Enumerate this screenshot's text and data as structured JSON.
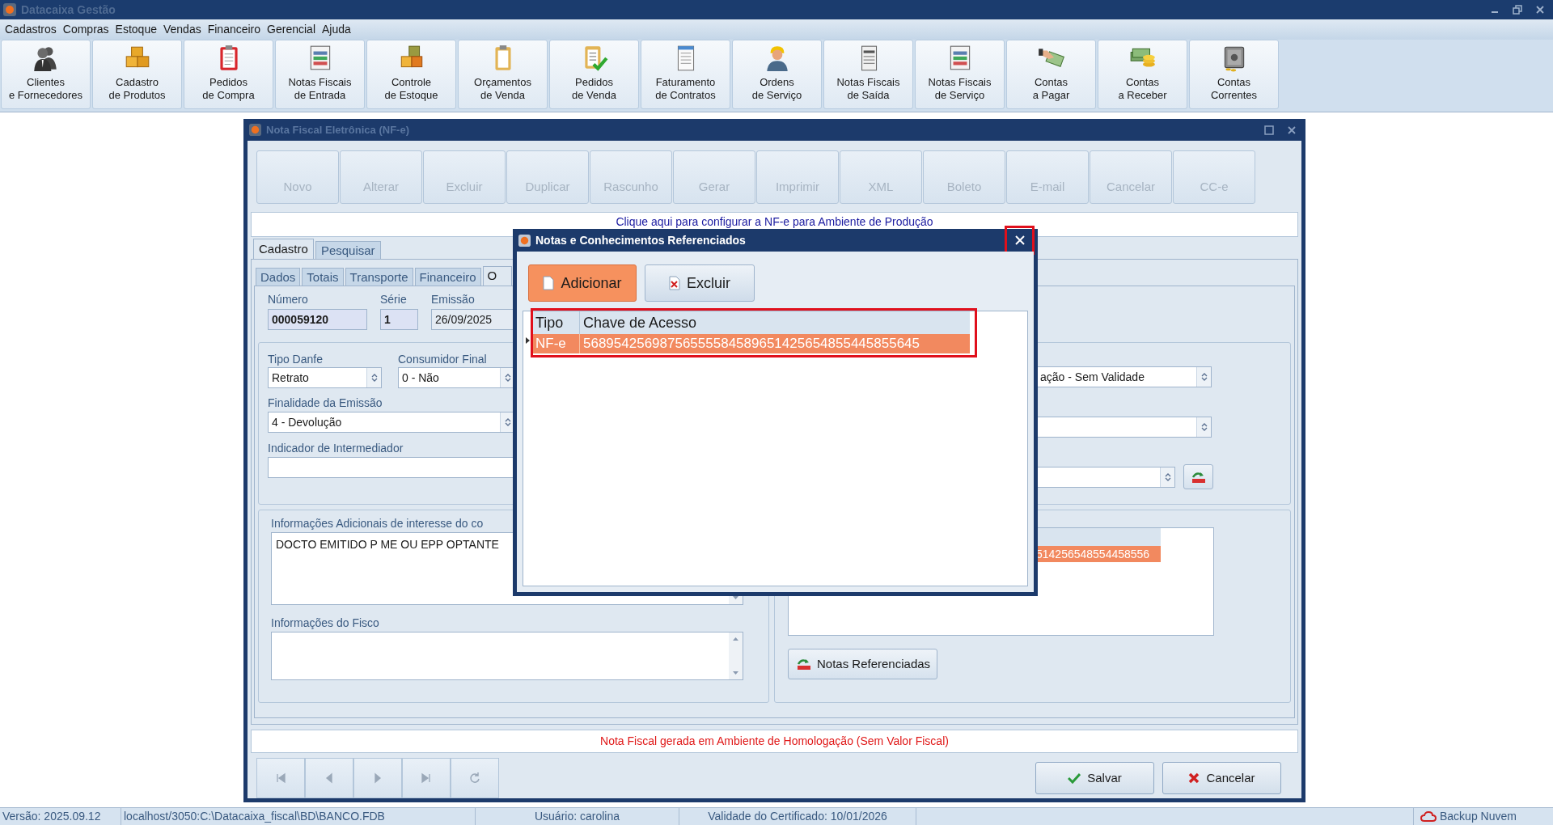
{
  "app": {
    "title": "Datacaixa Gestão"
  },
  "menu": [
    "Cadastros",
    "Compras",
    "Estoque",
    "Vendas",
    "Financeiro",
    "Gerencial",
    "Ajuda"
  ],
  "toolbar": [
    {
      "label": "Clientes\ne Fornecedores"
    },
    {
      "label": "Cadastro\nde Produtos"
    },
    {
      "label": "Pedidos\nde Compra"
    },
    {
      "label": "Notas Fiscais\nde Entrada"
    },
    {
      "label": "Controle\nde Estoque"
    },
    {
      "label": "Orçamentos\nde Venda"
    },
    {
      "label": "Pedidos\nde Venda"
    },
    {
      "label": "Faturamento\nde Contratos"
    },
    {
      "label": "Ordens\nde Serviço"
    },
    {
      "label": "Notas Fiscais\nde Saída"
    },
    {
      "label": "Notas Fiscais\nde Serviço"
    },
    {
      "label": "Contas\na Pagar"
    },
    {
      "label": "Contas\na Receber"
    },
    {
      "label": "Contas\nCorrentes"
    }
  ],
  "nfe_window": {
    "title": "Nota Fiscal Eletrônica (NF-e)",
    "actions": [
      {
        "label": "Novo",
        "disabled": true
      },
      {
        "label": "Alterar",
        "disabled": true
      },
      {
        "label": "Excluir",
        "disabled": true
      },
      {
        "label": "Duplicar",
        "disabled": true
      },
      {
        "label": "Rascunho",
        "disabled": true
      },
      {
        "label": "Gerar",
        "disabled": true
      },
      {
        "label": "Imprimir",
        "disabled": true
      },
      {
        "label": "XML",
        "disabled": true
      },
      {
        "label": "Boleto",
        "disabled": true
      },
      {
        "label": "E-mail",
        "disabled": true
      },
      {
        "label": "Cancelar",
        "disabled": true
      },
      {
        "label": "CC-e",
        "disabled": true
      }
    ],
    "config_link": "Clique aqui para configurar a NF-e para Ambiente de Produção",
    "tabs": [
      {
        "label": "Cadastro",
        "selected": true
      },
      {
        "label": "Pesquisar",
        "selected": false
      }
    ],
    "subtabs": [
      {
        "label": "Dados",
        "selected": false
      },
      {
        "label": "Totais",
        "selected": false
      },
      {
        "label": "Transporte",
        "selected": false
      },
      {
        "label": "Financeiro",
        "selected": false
      },
      {
        "label": "O",
        "selected": true
      }
    ],
    "numero": {
      "label": "Número",
      "value": "000059120"
    },
    "serie": {
      "label": "Série",
      "value": "1"
    },
    "emissao": {
      "label": "Emissão",
      "value": "26/09/2025"
    },
    "tipo_danfe": {
      "label": "Tipo Danfe",
      "value": "Retrato"
    },
    "consumidor_final": {
      "label": "Consumidor Final",
      "value": "0 - Não"
    },
    "finalidade": {
      "label": "Finalidade da Emissão",
      "value": "4 - Devolução"
    },
    "intermediador": {
      "label": "Indicador de Intermediador"
    },
    "ambiente_select": {
      "value": "ação - Sem Validade"
    },
    "info_adicionais": {
      "label": "Informações Adicionais de interesse do co",
      "value": "DOCTO EMITIDO P ME OU EPP OPTANTE"
    },
    "info_fisco": {
      "label": "Informações do Fisco"
    },
    "ref_grid_cell": "514256548554458556",
    "ref_button": "Notas Referenciadas",
    "message": "Nota Fiscal gerada em Ambiente de Homologação (Sem Valor Fiscal)",
    "save": "Salvar",
    "cancel": "Cancelar"
  },
  "dialog": {
    "title": "Notas e Conhecimentos Referenciados",
    "add": "Adicionar",
    "remove": "Excluir",
    "columns": [
      "Tipo",
      "Chave de Acesso"
    ],
    "rows": [
      {
        "tipo": "NF-e",
        "chave": "56895425698756555584589651425654855445855645",
        "selected": true
      }
    ]
  },
  "status_bar": [
    "Versão: 2025.09.12",
    "localhost/3050:C:\\Datacaixa_fiscal\\BD\\BANCO.FDB",
    "Usuário: carolina",
    "Validade do Certificado: 10/01/2026",
    "Backup Nuvem"
  ]
}
